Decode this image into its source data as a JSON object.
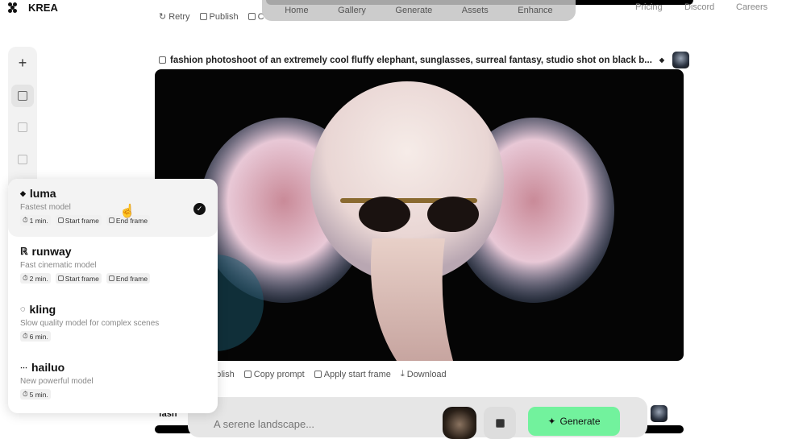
{
  "brand": {
    "name": "KREA"
  },
  "nav": {
    "items": [
      "Home",
      "Gallery",
      "Generate",
      "Assets",
      "Enhance"
    ],
    "right_links": [
      "Pricing",
      "Discord",
      "Careers"
    ]
  },
  "top_actions": {
    "retry": "Retry",
    "publish": "Publish",
    "copy": "C"
  },
  "prompt": {
    "text": "fashion photoshoot of an extremely cool fluffy elephant, sunglasses, surreal fantasy, studio shot on black b..."
  },
  "image_actions": {
    "publish": "ublish",
    "copy_prompt": "Copy prompt",
    "apply_start_frame": "Apply start frame",
    "download": "Download"
  },
  "next_prompt_fragment": "fash",
  "models": [
    {
      "name": "luma",
      "description": "Fastest model",
      "time": "1 min.",
      "tags": [
        "Start frame",
        "End frame"
      ],
      "selected": true
    },
    {
      "name": "runway",
      "description": "Fast cinematic model",
      "time": "2 min.",
      "tags": [
        "Start frame",
        "End frame"
      ],
      "selected": false
    },
    {
      "name": "kling",
      "description": "Slow quality model for complex scenes",
      "time": "6 min.",
      "tags": [],
      "selected": false
    },
    {
      "name": "hailuo",
      "description": "New powerful model",
      "time": "5 min.",
      "tags": [],
      "selected": false
    }
  ],
  "composer": {
    "placeholder": "A serene landscape...",
    "generate_label": "Generate"
  },
  "colors": {
    "accent": "#72f29d"
  }
}
